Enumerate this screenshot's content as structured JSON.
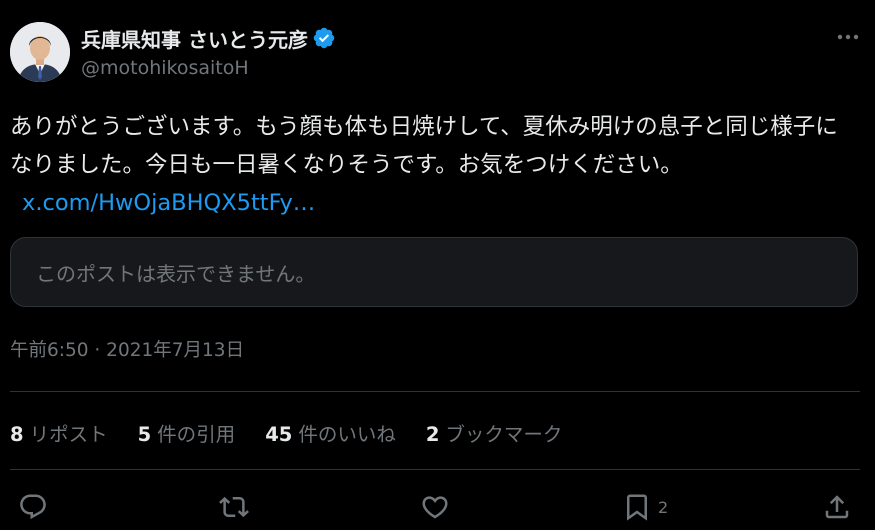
{
  "colors": {
    "background": "#000000",
    "text_primary": "#e7e9ea",
    "text_secondary": "#71767b",
    "link": "#1d9bf0",
    "verified_badge": "#1d9bf0",
    "divider": "#2f3336"
  },
  "author": {
    "display_name": "兵庫県知事 さいとう元彦",
    "handle": "@motohikosaitoH",
    "avatar_icon": "profile-photo",
    "verified_icon": "verified-badge-icon"
  },
  "menu": {
    "more_icon": "more-options-icon"
  },
  "tweet": {
    "text": "ありがとうございます。もう顔も体も日焼けして、夏休み明けの息子と同じ様子になりました。今日も一日暑くなりそうです。お気をつけください。",
    "link_text": "x.com/HwOjaBHQX5ttFy…"
  },
  "quoted": {
    "unavailable_text": "このポストは表示できません。"
  },
  "timestamp": "午前6:50 · 2021年7月13日",
  "stats": {
    "reposts": {
      "count": "8",
      "label": "リポスト"
    },
    "quotes": {
      "count": "5",
      "label": "件の引用"
    },
    "likes": {
      "count": "45",
      "label": "件のいいね"
    },
    "bookmarks": {
      "count": "2",
      "label": "ブックマーク"
    }
  },
  "actions": {
    "reply_icon": "reply-icon",
    "repost_icon": "repost-icon",
    "like_icon": "like-icon",
    "bookmark_icon": "bookmark-icon",
    "bookmark_count": "2",
    "share_icon": "share-icon"
  }
}
